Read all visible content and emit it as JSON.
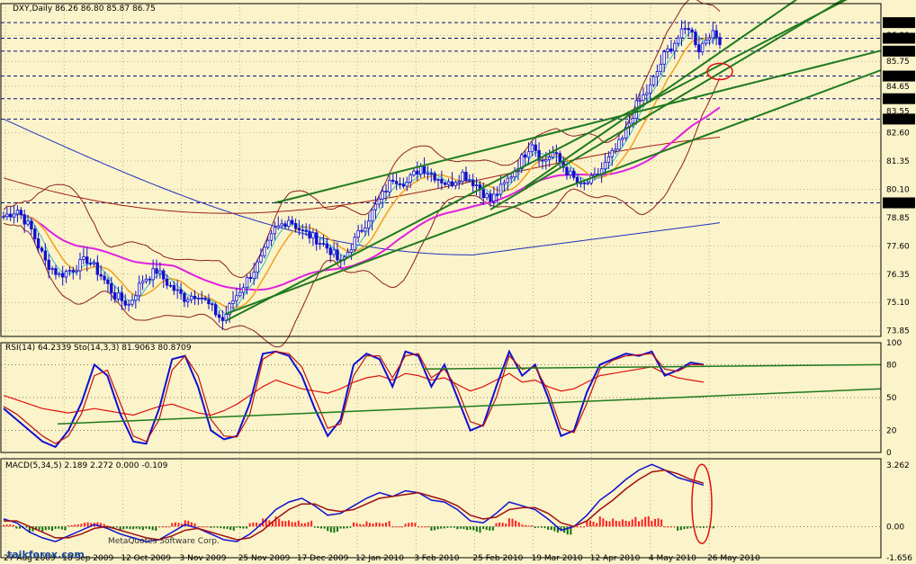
{
  "header": {
    "main": "DXY,Daily  86.26 86.80 85.87 86.75",
    "rsi": "RSI(14) 64.2339  Sto(14,3,3) 81.9063 80.8709",
    "macd": "MACD(5,34,5) 2.189 2.272 0.000 -0.109"
  },
  "watermark": {
    "copyright": "MetaQuotes Software Corp.",
    "site": "taikforex.com"
  },
  "colors": {
    "background": "#fbf3c9",
    "candle": "#1010d0",
    "trendline": "#1f7a1f",
    "ma_magenta": "#e020e0",
    "ma_blue": "#2030c0",
    "ma_orange": "#f0a020",
    "ma_cyan": "#30c0c0",
    "bands": "#8a2020",
    "macd_bar_pos": "#ff2020",
    "macd_bar_neg": "#107010",
    "circle": "#e01010"
  },
  "chart_data": [
    {
      "type": "candlestick",
      "panel": "price",
      "price_labels": [
        "87.46",
        "86.77",
        "86.20",
        "85.10",
        "84.10",
        "83.20",
        "79.50"
      ],
      "y_ticks": [
        "86.90",
        "85.75",
        "84.65",
        "83.55",
        "82.60",
        "81.35",
        "80.10",
        "78.85",
        "77.60",
        "76.35",
        "75.10",
        "73.85"
      ],
      "ylim": [
        73.6,
        88.3
      ],
      "x_labels": [
        "27 Aug 2009",
        "18 Sep 2009",
        "12 Oct 2009",
        "3 Nov 2009",
        "25 Nov 2009",
        "17 Dec 2009",
        "12 Jan 2010",
        "3 Feb 2010",
        "25 Feb 2010",
        "19 Mar 2010",
        "12 Apr 2010",
        "4 May 2010",
        "26 May 2010"
      ],
      "close_path": [
        [
          0,
          78.9
        ],
        [
          4,
          79.2
        ],
        [
          8,
          78.3
        ],
        [
          12,
          76.9
        ],
        [
          16,
          76.3
        ],
        [
          20,
          76.6
        ],
        [
          24,
          77.0
        ],
        [
          28,
          76.3
        ],
        [
          32,
          75.4
        ],
        [
          36,
          75.0
        ],
        [
          40,
          76.1
        ],
        [
          44,
          76.5
        ],
        [
          48,
          75.8
        ],
        [
          52,
          75.3
        ],
        [
          56,
          75.5
        ],
        [
          60,
          74.8
        ],
        [
          63,
          74.3
        ],
        [
          66,
          75.2
        ],
        [
          70,
          76.1
        ],
        [
          74,
          77.0
        ],
        [
          78,
          78.3
        ],
        [
          82,
          78.8
        ],
        [
          86,
          78.2
        ],
        [
          90,
          77.9
        ],
        [
          94,
          77.4
        ],
        [
          97,
          76.8
        ],
        [
          100,
          77.6
        ],
        [
          104,
          78.6
        ],
        [
          108,
          79.6
        ],
        [
          112,
          80.6
        ],
        [
          116,
          80.4
        ],
        [
          120,
          81.1
        ],
        [
          124,
          80.7
        ],
        [
          128,
          80.3
        ],
        [
          132,
          80.8
        ],
        [
          136,
          80.3
        ],
        [
          140,
          79.6
        ],
        [
          144,
          80.3
        ],
        [
          148,
          81.2
        ],
        [
          152,
          82.2
        ],
        [
          155,
          81.3
        ],
        [
          158,
          81.7
        ],
        [
          162,
          80.9
        ],
        [
          166,
          80.2
        ],
        [
          170,
          80.6
        ],
        [
          174,
          81.4
        ],
        [
          178,
          82.3
        ],
        [
          182,
          83.8
        ],
        [
          186,
          84.6
        ],
        [
          190,
          86.0
        ],
        [
          194,
          86.8
        ],
        [
          197,
          87.3
        ],
        [
          200,
          86.3
        ],
        [
          203,
          87.0
        ],
        [
          206,
          86.7
        ]
      ]
    },
    {
      "type": "line",
      "panel": "oscillator",
      "y_ticks": [
        "100",
        "80",
        "50",
        "20",
        "0"
      ],
      "ylim": [
        0,
        100
      ],
      "series": [
        {
          "name": "RSI(14)",
          "values": [
            52,
            48,
            44,
            40,
            38,
            36,
            38,
            40,
            38,
            36,
            34,
            38,
            42,
            44,
            40,
            36,
            34,
            38,
            44,
            52,
            60,
            66,
            62,
            58,
            56,
            54,
            58,
            64,
            68,
            70,
            66,
            72,
            70,
            66,
            68,
            62,
            56,
            60,
            66,
            72,
            64,
            66,
            60,
            56,
            58,
            64,
            70,
            72,
            74,
            76,
            78,
            72,
            68,
            66,
            64
          ]
        },
        {
          "name": "Sto(14,3,3)",
          "values": [
            40,
            30,
            20,
            10,
            5,
            20,
            45,
            80,
            70,
            35,
            10,
            8,
            40,
            85,
            88,
            60,
            20,
            12,
            15,
            45,
            90,
            92,
            88,
            70,
            40,
            15,
            30,
            80,
            90,
            85,
            60,
            92,
            88,
            60,
            80,
            50,
            20,
            25,
            60,
            92,
            70,
            80,
            50,
            15,
            20,
            55,
            80,
            85,
            90,
            88,
            92,
            70,
            75,
            82,
            80
          ]
        },
        {
          "name": "Sto signal",
          "values": [
            42,
            35,
            25,
            15,
            8,
            15,
            35,
            70,
            75,
            45,
            15,
            10,
            30,
            75,
            88,
            70,
            30,
            15,
            14,
            35,
            85,
            92,
            90,
            78,
            50,
            22,
            26,
            70,
            88,
            88,
            68,
            88,
            90,
            68,
            76,
            58,
            28,
            24,
            50,
            88,
            76,
            78,
            56,
            22,
            18,
            45,
            76,
            84,
            88,
            89,
            90,
            76,
            74,
            80,
            80
          ]
        }
      ]
    },
    {
      "type": "macd",
      "panel": "macd",
      "y_ticks": [
        "3.262",
        "0.00",
        "-1.656"
      ],
      "ylim": [
        -1.656,
        3.6
      ],
      "series": [
        {
          "name": "MACD",
          "values": [
            0.4,
            0.2,
            -0.3,
            -0.6,
            -0.8,
            -0.5,
            -0.2,
            0.1,
            -0.1,
            -0.4,
            -0.6,
            -0.8,
            -0.7,
            -0.3,
            0.1,
            -0.1,
            -0.4,
            -0.7,
            -0.8,
            -0.4,
            0.2,
            0.9,
            1.3,
            1.5,
            1.1,
            0.6,
            0.7,
            1.1,
            1.5,
            1.8,
            1.6,
            1.9,
            1.8,
            1.4,
            1.3,
            0.9,
            0.3,
            0.2,
            0.7,
            1.3,
            1.1,
            0.9,
            0.4,
            -0.2,
            0.0,
            0.6,
            1.4,
            1.9,
            2.5,
            3.0,
            3.3,
            3.0,
            2.6,
            2.4,
            2.2
          ]
        },
        {
          "name": "Signal",
          "values": [
            0.3,
            0.3,
            0.0,
            -0.3,
            -0.6,
            -0.6,
            -0.4,
            -0.1,
            0.0,
            -0.2,
            -0.4,
            -0.6,
            -0.7,
            -0.5,
            -0.2,
            -0.1,
            -0.3,
            -0.5,
            -0.7,
            -0.6,
            -0.2,
            0.4,
            0.9,
            1.2,
            1.2,
            0.9,
            0.8,
            0.9,
            1.2,
            1.5,
            1.6,
            1.7,
            1.8,
            1.6,
            1.4,
            1.1,
            0.6,
            0.4,
            0.5,
            0.9,
            1.0,
            1.0,
            0.7,
            0.2,
            0.0,
            0.3,
            0.9,
            1.4,
            2.0,
            2.5,
            2.9,
            3.0,
            2.8,
            2.5,
            2.3
          ]
        }
      ]
    }
  ]
}
